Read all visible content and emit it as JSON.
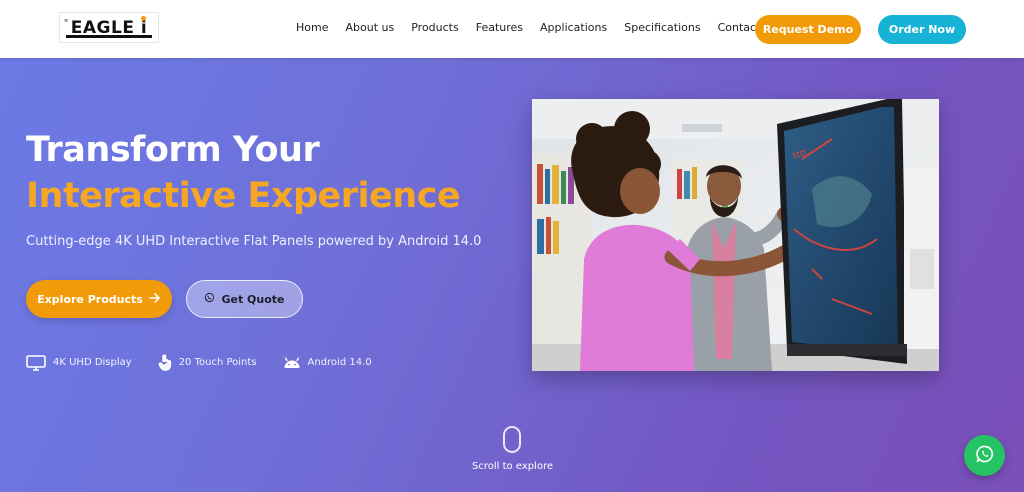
{
  "brand": {
    "logo_text": "EAGLE"
  },
  "nav": {
    "links": [
      "Home",
      "About us",
      "Products",
      "Features",
      "Applications",
      "Specifications",
      "Contact us"
    ],
    "request_demo": "Request Demo",
    "order_now": "Order Now"
  },
  "hero": {
    "title_line1": "Transform Your",
    "title_line2": "Interactive Experience",
    "subtitle": "Cutting-edge 4K UHD Interactive Flat Panels powered by Android 14.0",
    "explore_button": "Explore Products",
    "quote_button": "Get Quote",
    "features": [
      {
        "icon": "monitor-icon",
        "label": "4K UHD Display"
      },
      {
        "icon": "touch-hand-icon",
        "label": "20 Touch Points"
      },
      {
        "icon": "android-icon",
        "label": "Android 14.0"
      }
    ]
  },
  "scroll": {
    "label": "Scroll to explore"
  },
  "colors": {
    "accent_orange": "#f29b0a",
    "accent_cyan": "#17b3d6",
    "whatsapp_green": "#25c364",
    "hero_gradient_start": "#6c7ae6",
    "hero_gradient_end": "#7a4fb8"
  }
}
